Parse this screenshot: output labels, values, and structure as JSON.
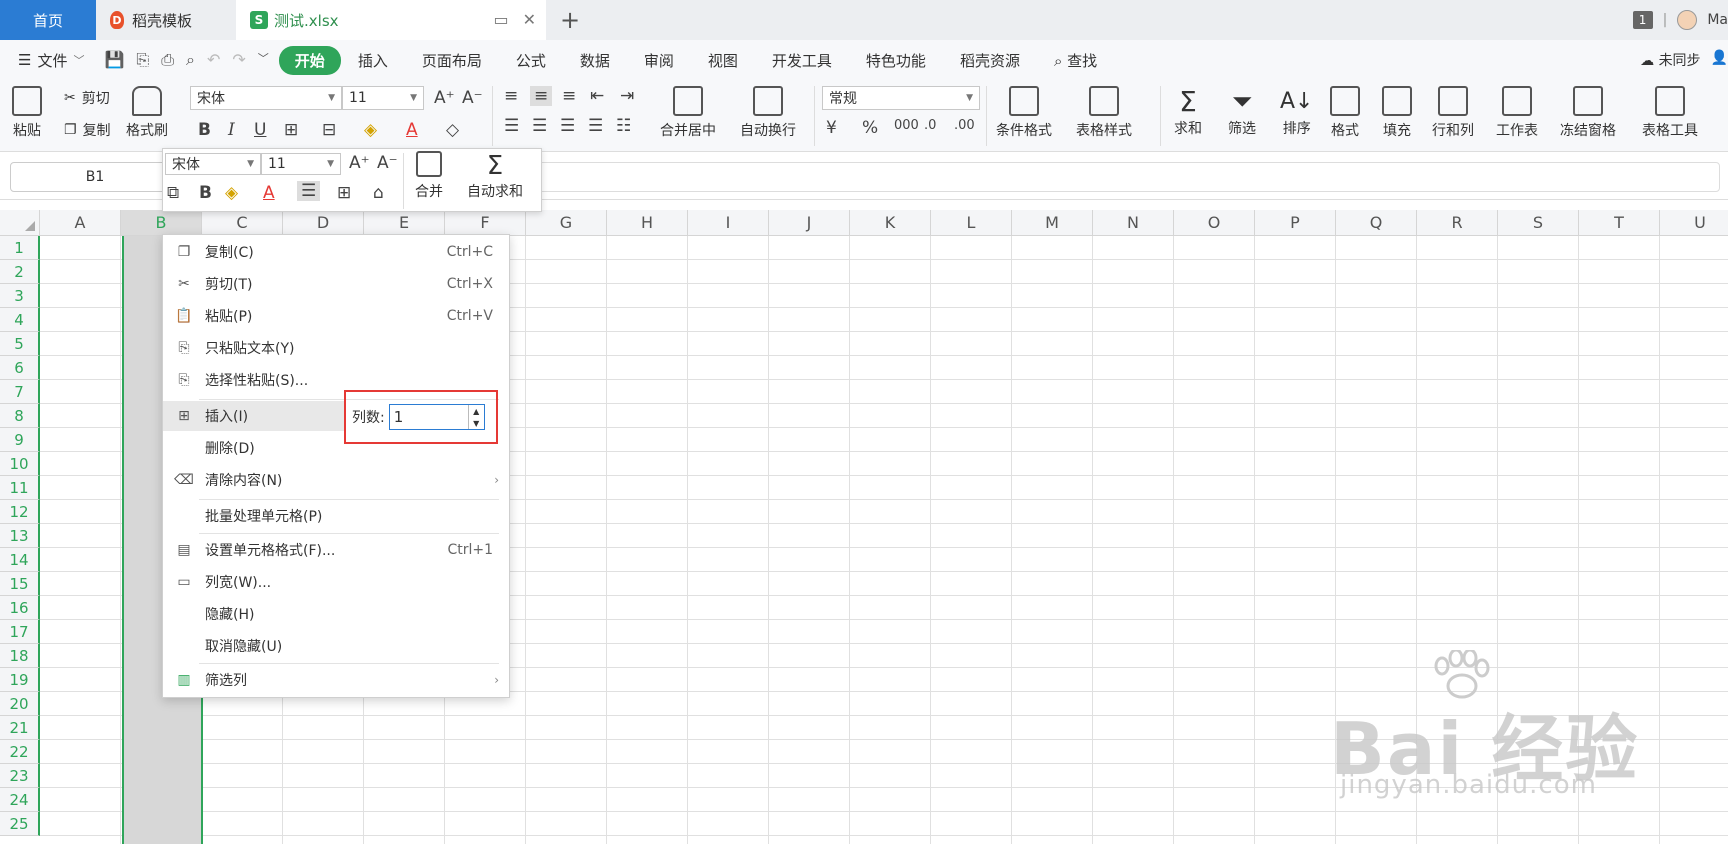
{
  "tabs": {
    "home": "首页",
    "docer": "稻壳模板",
    "file": "测试.xlsx",
    "plus": "+"
  },
  "topright": {
    "window_count": "1",
    "user": "Ma"
  },
  "menu": {
    "file_label": "文件",
    "tabs": [
      "开始",
      "插入",
      "页面布局",
      "公式",
      "数据",
      "审阅",
      "视图",
      "开发工具",
      "特色功能",
      "稻壳资源"
    ],
    "search": "查找",
    "sync": "未同步"
  },
  "ribbon": {
    "paste": "粘贴",
    "cut": "剪切",
    "copy": "复制",
    "format_painter": "格式刷",
    "font_name": "宋体",
    "font_size": "11",
    "merge": "合并居中",
    "wrap": "自动换行",
    "number_format": "常规",
    "cond_format": "条件格式",
    "table_style": "表格样式",
    "sum": "求和",
    "filter": "筛选",
    "sort": "排序",
    "format": "格式",
    "fill": "填充",
    "row_col": "行和列",
    "sheet": "工作表",
    "freeze": "冻结窗格",
    "table_tools": "表格工具"
  },
  "formula_bar": {
    "name_box": "B1"
  },
  "columns": [
    "A",
    "B",
    "C",
    "D",
    "E",
    "F",
    "G",
    "H",
    "I",
    "J",
    "K",
    "L",
    "M",
    "N",
    "O",
    "P",
    "Q",
    "R",
    "S",
    "T",
    "U"
  ],
  "selected_column": "B",
  "rows": [
    "1",
    "2",
    "3",
    "4",
    "5",
    "6",
    "7",
    "8",
    "9",
    "10",
    "11",
    "12",
    "13",
    "14",
    "15",
    "16",
    "17",
    "18",
    "19",
    "20",
    "21",
    "22",
    "23",
    "24",
    "25"
  ],
  "mini_toolbar": {
    "font_name": "宋体",
    "font_size": "11",
    "merge": "合并",
    "autosum": "自动求和"
  },
  "context_menu": {
    "items": [
      {
        "label": "复制(C)",
        "shortcut": "Ctrl+C"
      },
      {
        "label": "剪切(T)",
        "shortcut": "Ctrl+X"
      },
      {
        "label": "粘贴(P)",
        "shortcut": "Ctrl+V"
      },
      {
        "label": "只粘贴文本(Y)",
        "shortcut": ""
      },
      {
        "label": "选择性粘贴(S)...",
        "shortcut": ""
      },
      {
        "label": "插入(I)",
        "shortcut": ""
      },
      {
        "label": "删除(D)",
        "shortcut": ""
      },
      {
        "label": "清除内容(N)",
        "shortcut": ""
      },
      {
        "label": "批量处理单元格(P)",
        "shortcut": ""
      },
      {
        "label": "设置单元格格式(F)...",
        "shortcut": "Ctrl+1"
      },
      {
        "label": "列宽(W)...",
        "shortcut": ""
      },
      {
        "label": "隐藏(H)",
        "shortcut": ""
      },
      {
        "label": "取消隐藏(U)",
        "shortcut": ""
      },
      {
        "label": "筛选列",
        "shortcut": ""
      }
    ],
    "insert_count_label": "列数:",
    "insert_count_value": "1"
  },
  "watermark": {
    "brand": "Bai 经验",
    "url": "jingyan.baidu.com"
  },
  "colors": {
    "accent": "#2fa55a",
    "home_tab": "#2b7cd3",
    "highlight_box": "#e53935"
  }
}
